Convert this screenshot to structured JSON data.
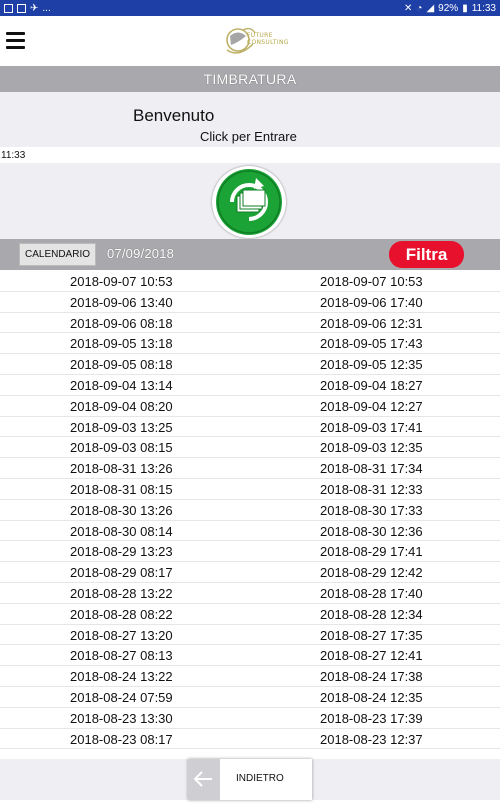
{
  "status_bar": {
    "left_icons": [
      "image-icon",
      "flipboard-icon",
      "android-icon"
    ],
    "left_more": "...",
    "battery_percent": "92%",
    "time": "11:33"
  },
  "app_bar": {
    "menu_icon": "hamburger-menu-icon",
    "logo_line1": "FUTURE",
    "logo_line2": "CONSULTING"
  },
  "title": "TIMBRATURA",
  "welcome": {
    "greeting": "Benvenuto",
    "instruction": "Click per Entrare",
    "current_time": "11:33"
  },
  "action": {
    "icon": "refresh-folder-icon",
    "accent": "#1ca336"
  },
  "filter_bar": {
    "calendar_label": "CALENDARIO",
    "date": "07/09/2018",
    "filter_label": "Filtra",
    "filter_color": "#e8112d"
  },
  "entries": [
    {
      "in": "2018-09-07 10:53",
      "out": "2018-09-07 10:53"
    },
    {
      "in": "2018-09-06 13:40",
      "out": "2018-09-06 17:40"
    },
    {
      "in": "2018-09-06 08:18",
      "out": "2018-09-06 12:31"
    },
    {
      "in": "2018-09-05 13:18",
      "out": "2018-09-05 17:43"
    },
    {
      "in": "2018-09-05 08:18",
      "out": "2018-09-05 12:35"
    },
    {
      "in": "2018-09-04 13:14",
      "out": "2018-09-04 18:27"
    },
    {
      "in": "2018-09-04 08:20",
      "out": "2018-09-04 12:27"
    },
    {
      "in": "2018-09-03 13:25",
      "out": "2018-09-03 17:41"
    },
    {
      "in": "2018-09-03 08:15",
      "out": "2018-09-03 12:35"
    },
    {
      "in": "2018-08-31 13:26",
      "out": "2018-08-31 17:34"
    },
    {
      "in": "2018-08-31 08:15",
      "out": "2018-08-31 12:33"
    },
    {
      "in": "2018-08-30 13:26",
      "out": "2018-08-30 17:33"
    },
    {
      "in": "2018-08-30 08:14",
      "out": "2018-08-30 12:36"
    },
    {
      "in": "2018-08-29 13:23",
      "out": "2018-08-29 17:41"
    },
    {
      "in": "2018-08-29 08:17",
      "out": "2018-08-29 12:42"
    },
    {
      "in": "2018-08-28 13:22",
      "out": "2018-08-28 17:40"
    },
    {
      "in": "2018-08-28 08:22",
      "out": "2018-08-28 12:34"
    },
    {
      "in": "2018-08-27 13:20",
      "out": "2018-08-27 17:35"
    },
    {
      "in": "2018-08-27 08:13",
      "out": "2018-08-27 12:41"
    },
    {
      "in": "2018-08-24 13:22",
      "out": "2018-08-24 17:38"
    },
    {
      "in": "2018-08-24 07:59",
      "out": "2018-08-24 12:35"
    },
    {
      "in": "2018-08-23 13:30",
      "out": "2018-08-23 17:39"
    },
    {
      "in": "2018-08-23 08:17",
      "out": "2018-08-23 12:37"
    }
  ],
  "footer": {
    "back_icon": "arrow-left-icon",
    "back_label": "INDIETRO"
  }
}
